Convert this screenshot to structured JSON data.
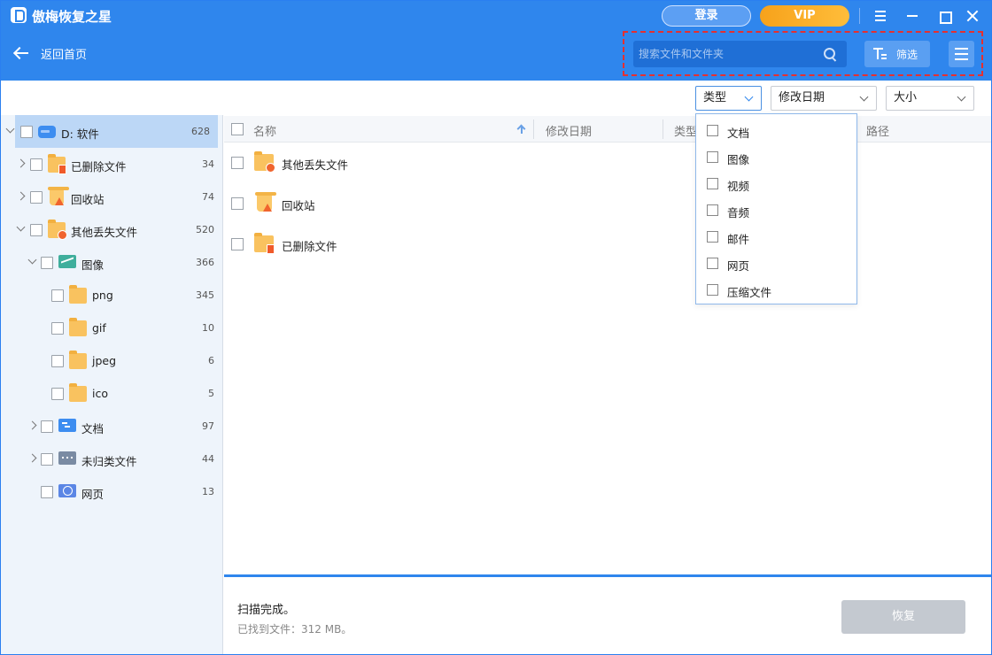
{
  "app": {
    "title": "傲梅恢复之星",
    "login_label": "登录",
    "vip_label": "VIP"
  },
  "toolbar": {
    "back_label": "返回首页",
    "search_placeholder": "搜索文件和文件夹",
    "filter_label": "筛选"
  },
  "filters": {
    "type_label": "类型",
    "date_label": "修改日期",
    "size_label": "大小"
  },
  "tree": {
    "drive": {
      "label": "D: 软件",
      "count": "628"
    },
    "items": [
      {
        "label": "已删除文件",
        "count": "34"
      },
      {
        "label": "回收站",
        "count": "74"
      },
      {
        "label": "其他丢失文件",
        "count": "520"
      },
      {
        "label": "图像",
        "count": "366"
      },
      {
        "label": "png",
        "count": "345"
      },
      {
        "label": "gif",
        "count": "10"
      },
      {
        "label": "jpeg",
        "count": "6"
      },
      {
        "label": "ico",
        "count": "5"
      },
      {
        "label": "文档",
        "count": "97"
      },
      {
        "label": "未归类文件",
        "count": "44"
      },
      {
        "label": "网页",
        "count": "13"
      }
    ]
  },
  "list": {
    "columns": {
      "name": "名称",
      "date": "修改日期",
      "type": "类型",
      "path": "路径"
    },
    "rows": [
      {
        "name": "其他丢失文件"
      },
      {
        "name": "回收站"
      },
      {
        "name": "已删除文件"
      }
    ]
  },
  "type_menu": {
    "options": [
      "文档",
      "图像",
      "视频",
      "音频",
      "邮件",
      "网页",
      "压缩文件"
    ]
  },
  "status": {
    "title": "扫描完成。",
    "found": "已找到文件：312 MB。",
    "recover_label": "恢复"
  },
  "colors": {
    "header": "#2f86ed",
    "vip": "#f7a21b",
    "highlight_border": "#e53030"
  }
}
